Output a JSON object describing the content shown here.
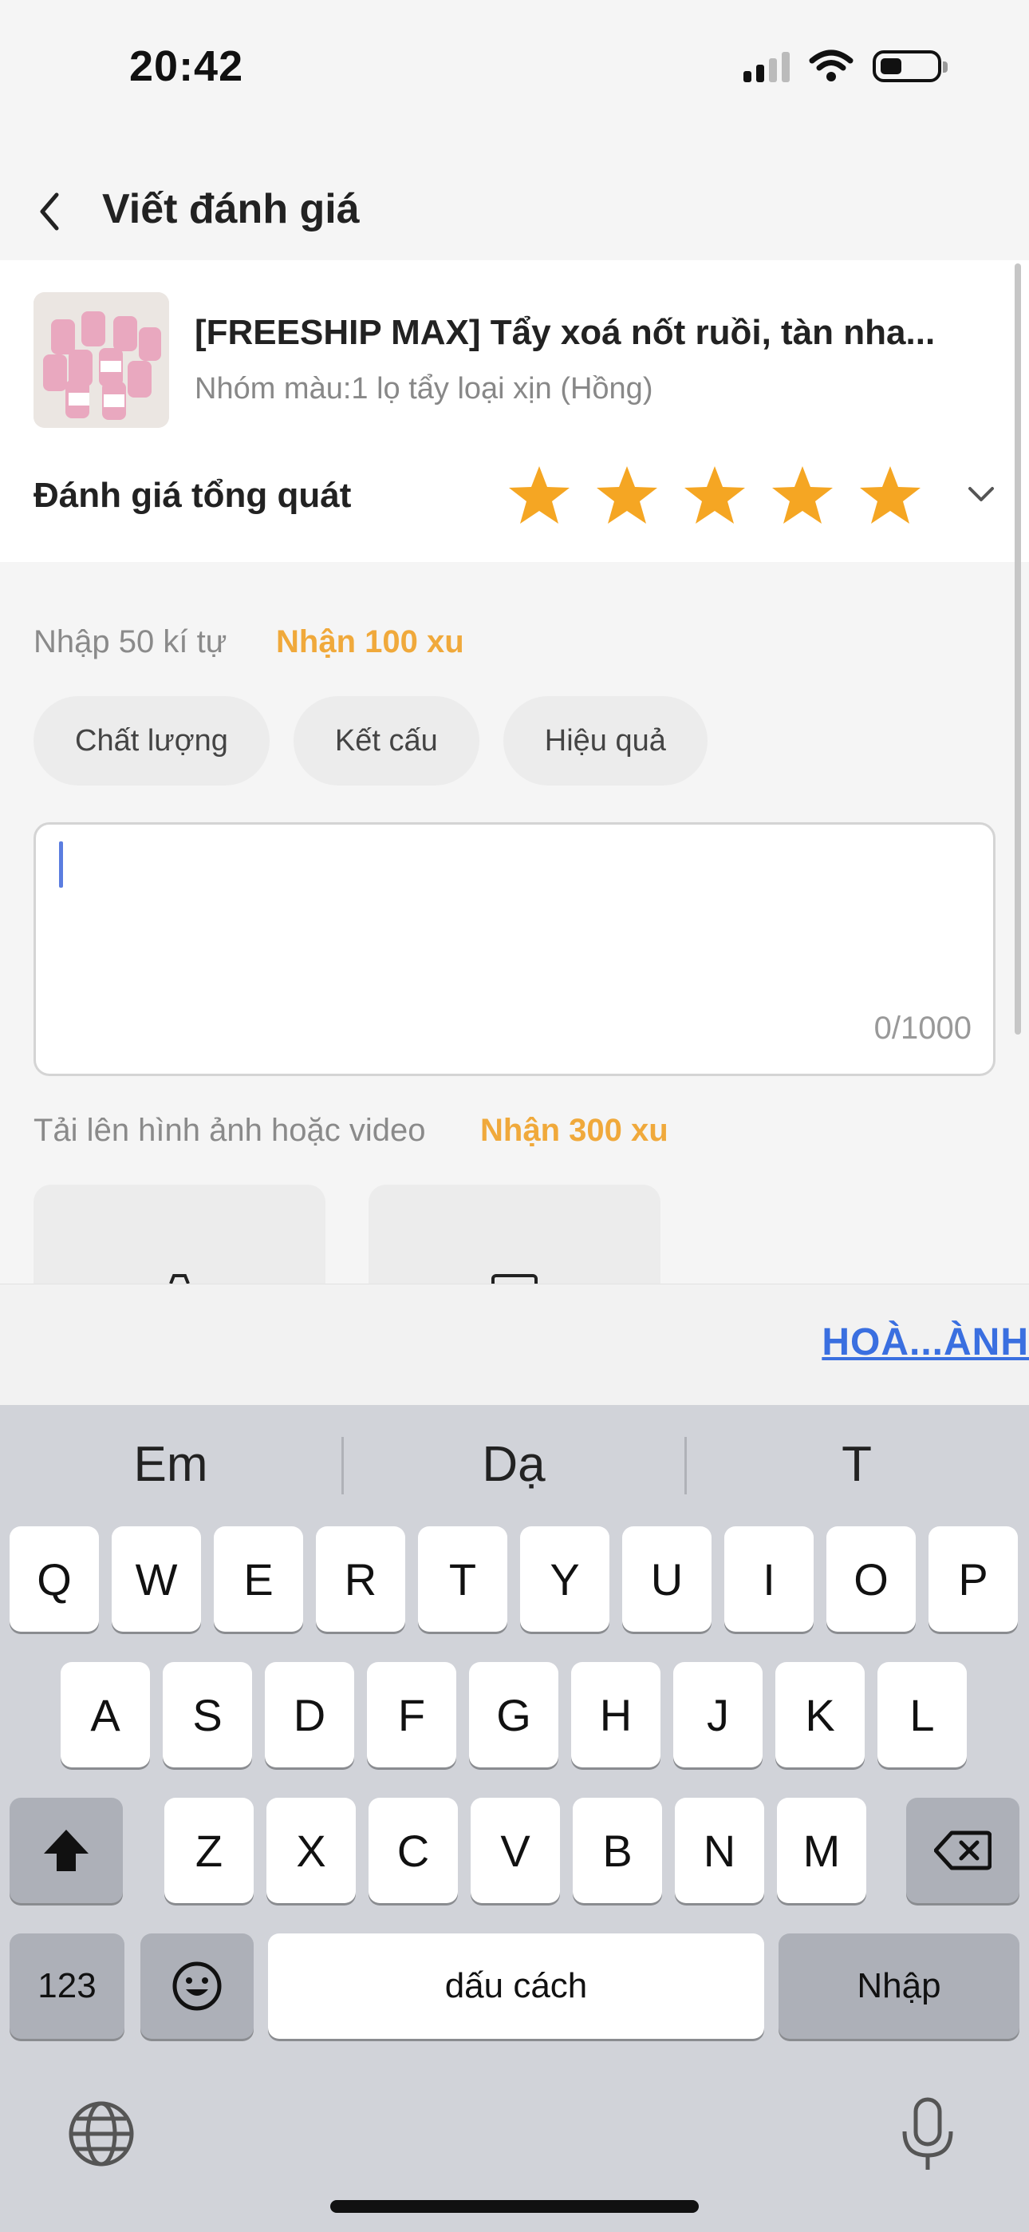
{
  "status_bar": {
    "time": "20:42"
  },
  "header": {
    "title": "Viết đánh giá"
  },
  "product": {
    "name": "[FREESHIP MAX] Tẩy xoá nốt ruồi, tàn nha...",
    "variant": "Nhóm màu:1 lọ tẩy loại xịn (Hồng)"
  },
  "rating": {
    "label": "Đánh giá tổng quát",
    "stars": 5,
    "max": 5,
    "star_color": "#f5a623"
  },
  "review": {
    "hint": "Nhập 50 kí tự",
    "hint_reward": "Nhận 100 xu",
    "tags": [
      "Chất lượng",
      "Kết cấu",
      "Hiệu quả"
    ],
    "value": "",
    "counter": "0/1000"
  },
  "upload": {
    "label": "Tải lên hình ảnh hoặc video",
    "reward": "Nhận 300 xu"
  },
  "done_label": "HOÀ...ÀNH",
  "keyboard": {
    "suggestions": [
      "Em",
      "Dạ",
      "T"
    ],
    "row1": [
      "Q",
      "W",
      "E",
      "R",
      "T",
      "Y",
      "U",
      "I",
      "O",
      "P"
    ],
    "row2": [
      "A",
      "S",
      "D",
      "F",
      "G",
      "H",
      "J",
      "K",
      "L"
    ],
    "row3": [
      "Z",
      "X",
      "C",
      "V",
      "B",
      "N",
      "M"
    ],
    "numbers_key": "123",
    "space_key": "dấu cách",
    "return_key": "Nhập"
  },
  "colors": {
    "accent_orange": "#f0a93b",
    "link_blue": "#3a6fe0",
    "caret_blue": "#5b7de0"
  }
}
